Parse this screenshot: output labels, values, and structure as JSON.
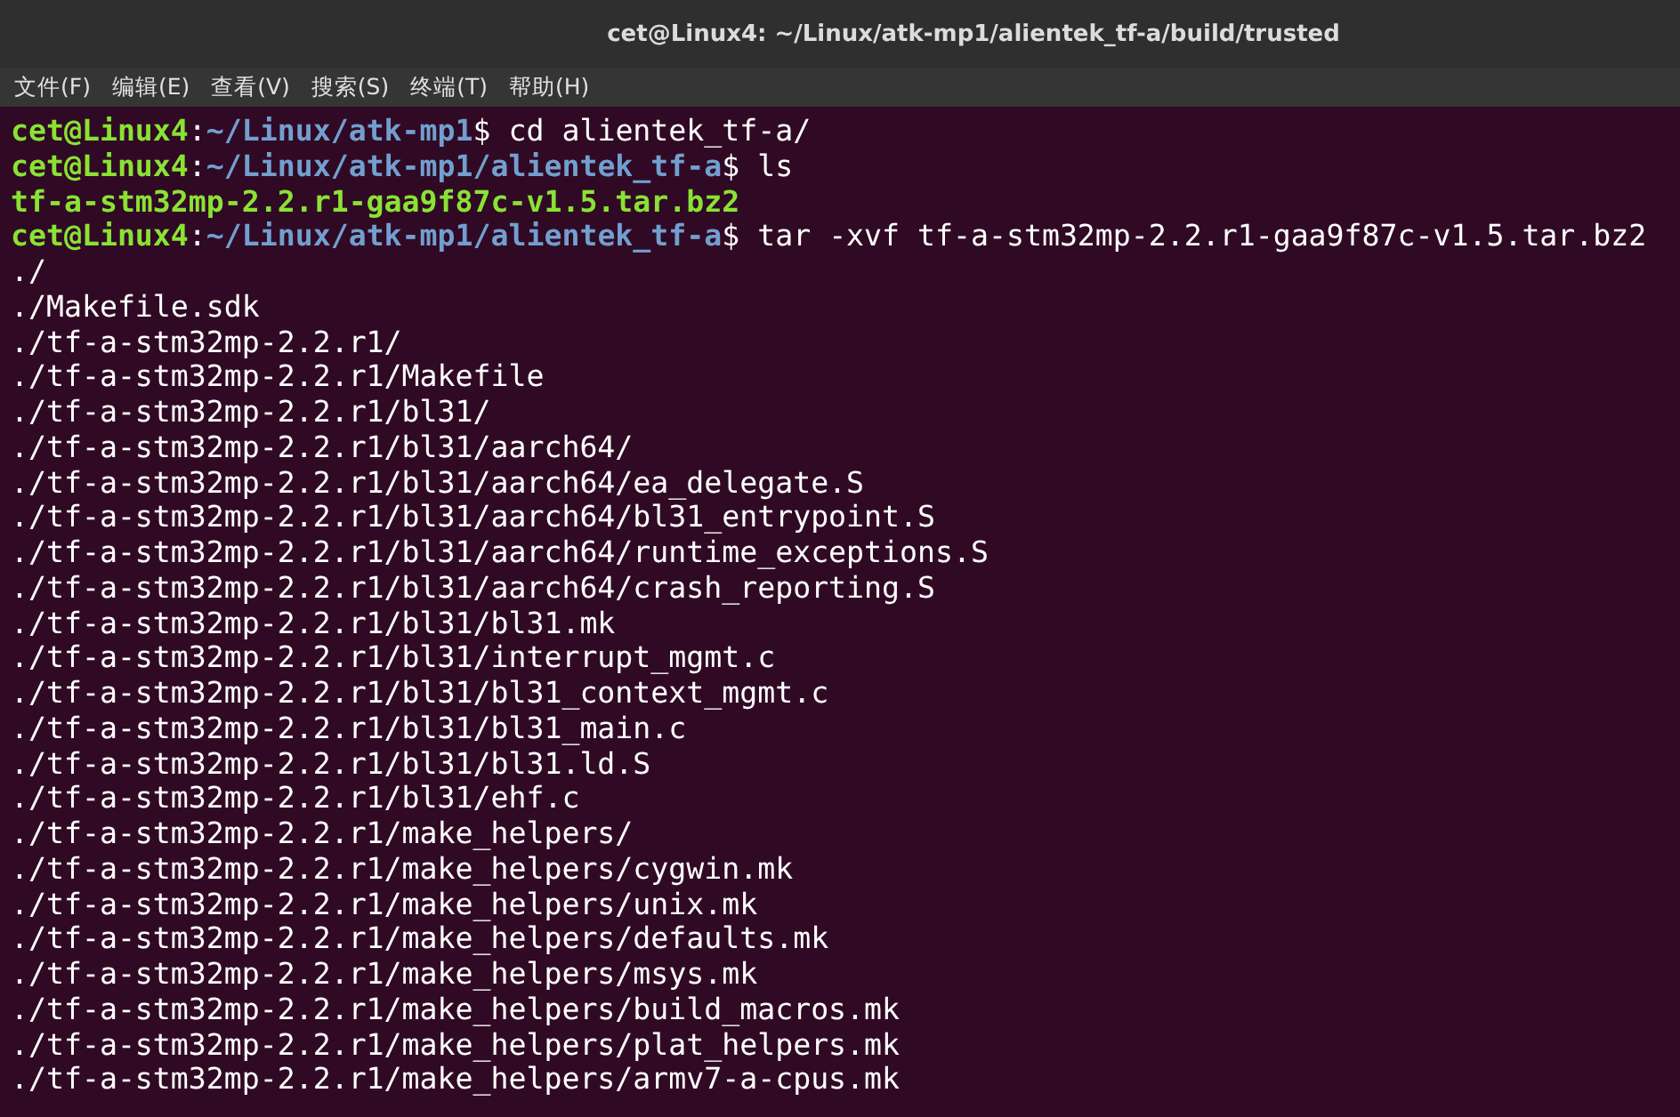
{
  "window": {
    "title": "cet@Linux4: ~/Linux/atk-mp1/alientek_tf-a/build/trusted"
  },
  "menu": [
    "文件(F)",
    "编辑(E)",
    "查看(V)",
    "搜索(S)",
    "终端(T)",
    "帮助(H)"
  ],
  "lines": [
    {
      "kind": "prompt",
      "user": "cet@Linux4",
      "separator": ":",
      "path": "~/Linux/atk-mp1",
      "dollar": "$",
      "command": "cd alientek_tf-a/"
    },
    {
      "kind": "prompt",
      "user": "cet@Linux4",
      "separator": ":",
      "path": "~/Linux/atk-mp1/alientek_tf-a",
      "dollar": "$",
      "command": "ls"
    },
    {
      "kind": "archive",
      "text": "tf-a-stm32mp-2.2.r1-gaa9f87c-v1.5.tar.bz2"
    },
    {
      "kind": "prompt",
      "user": "cet@Linux4",
      "separator": ":",
      "path": "~/Linux/atk-mp1/alientek_tf-a",
      "dollar": "$",
      "command": "tar -xvf tf-a-stm32mp-2.2.r1-gaa9f87c-v1.5.tar.bz2"
    },
    {
      "kind": "output",
      "text": "./"
    },
    {
      "kind": "output",
      "text": "./Makefile.sdk"
    },
    {
      "kind": "output",
      "text": "./tf-a-stm32mp-2.2.r1/"
    },
    {
      "kind": "output",
      "text": "./tf-a-stm32mp-2.2.r1/Makefile"
    },
    {
      "kind": "output",
      "text": "./tf-a-stm32mp-2.2.r1/bl31/"
    },
    {
      "kind": "output",
      "text": "./tf-a-stm32mp-2.2.r1/bl31/aarch64/"
    },
    {
      "kind": "output",
      "text": "./tf-a-stm32mp-2.2.r1/bl31/aarch64/ea_delegate.S"
    },
    {
      "kind": "output",
      "text": "./tf-a-stm32mp-2.2.r1/bl31/aarch64/bl31_entrypoint.S"
    },
    {
      "kind": "output",
      "text": "./tf-a-stm32mp-2.2.r1/bl31/aarch64/runtime_exceptions.S"
    },
    {
      "kind": "output",
      "text": "./tf-a-stm32mp-2.2.r1/bl31/aarch64/crash_reporting.S"
    },
    {
      "kind": "output",
      "text": "./tf-a-stm32mp-2.2.r1/bl31/bl31.mk"
    },
    {
      "kind": "output",
      "text": "./tf-a-stm32mp-2.2.r1/bl31/interrupt_mgmt.c"
    },
    {
      "kind": "output",
      "text": "./tf-a-stm32mp-2.2.r1/bl31/bl31_context_mgmt.c"
    },
    {
      "kind": "output",
      "text": "./tf-a-stm32mp-2.2.r1/bl31/bl31_main.c"
    },
    {
      "kind": "output",
      "text": "./tf-a-stm32mp-2.2.r1/bl31/bl31.ld.S"
    },
    {
      "kind": "output",
      "text": "./tf-a-stm32mp-2.2.r1/bl31/ehf.c"
    },
    {
      "kind": "output",
      "text": "./tf-a-stm32mp-2.2.r1/make_helpers/"
    },
    {
      "kind": "output",
      "text": "./tf-a-stm32mp-2.2.r1/make_helpers/cygwin.mk"
    },
    {
      "kind": "output",
      "text": "./tf-a-stm32mp-2.2.r1/make_helpers/unix.mk"
    },
    {
      "kind": "output",
      "text": "./tf-a-stm32mp-2.2.r1/make_helpers/defaults.mk"
    },
    {
      "kind": "output",
      "text": "./tf-a-stm32mp-2.2.r1/make_helpers/msys.mk"
    },
    {
      "kind": "output",
      "text": "./tf-a-stm32mp-2.2.r1/make_helpers/build_macros.mk"
    },
    {
      "kind": "output",
      "text": "./tf-a-stm32mp-2.2.r1/make_helpers/plat_helpers.mk"
    },
    {
      "kind": "output",
      "text": "./tf-a-stm32mp-2.2.r1/make_helpers/armv7-a-cpus.mk"
    }
  ]
}
